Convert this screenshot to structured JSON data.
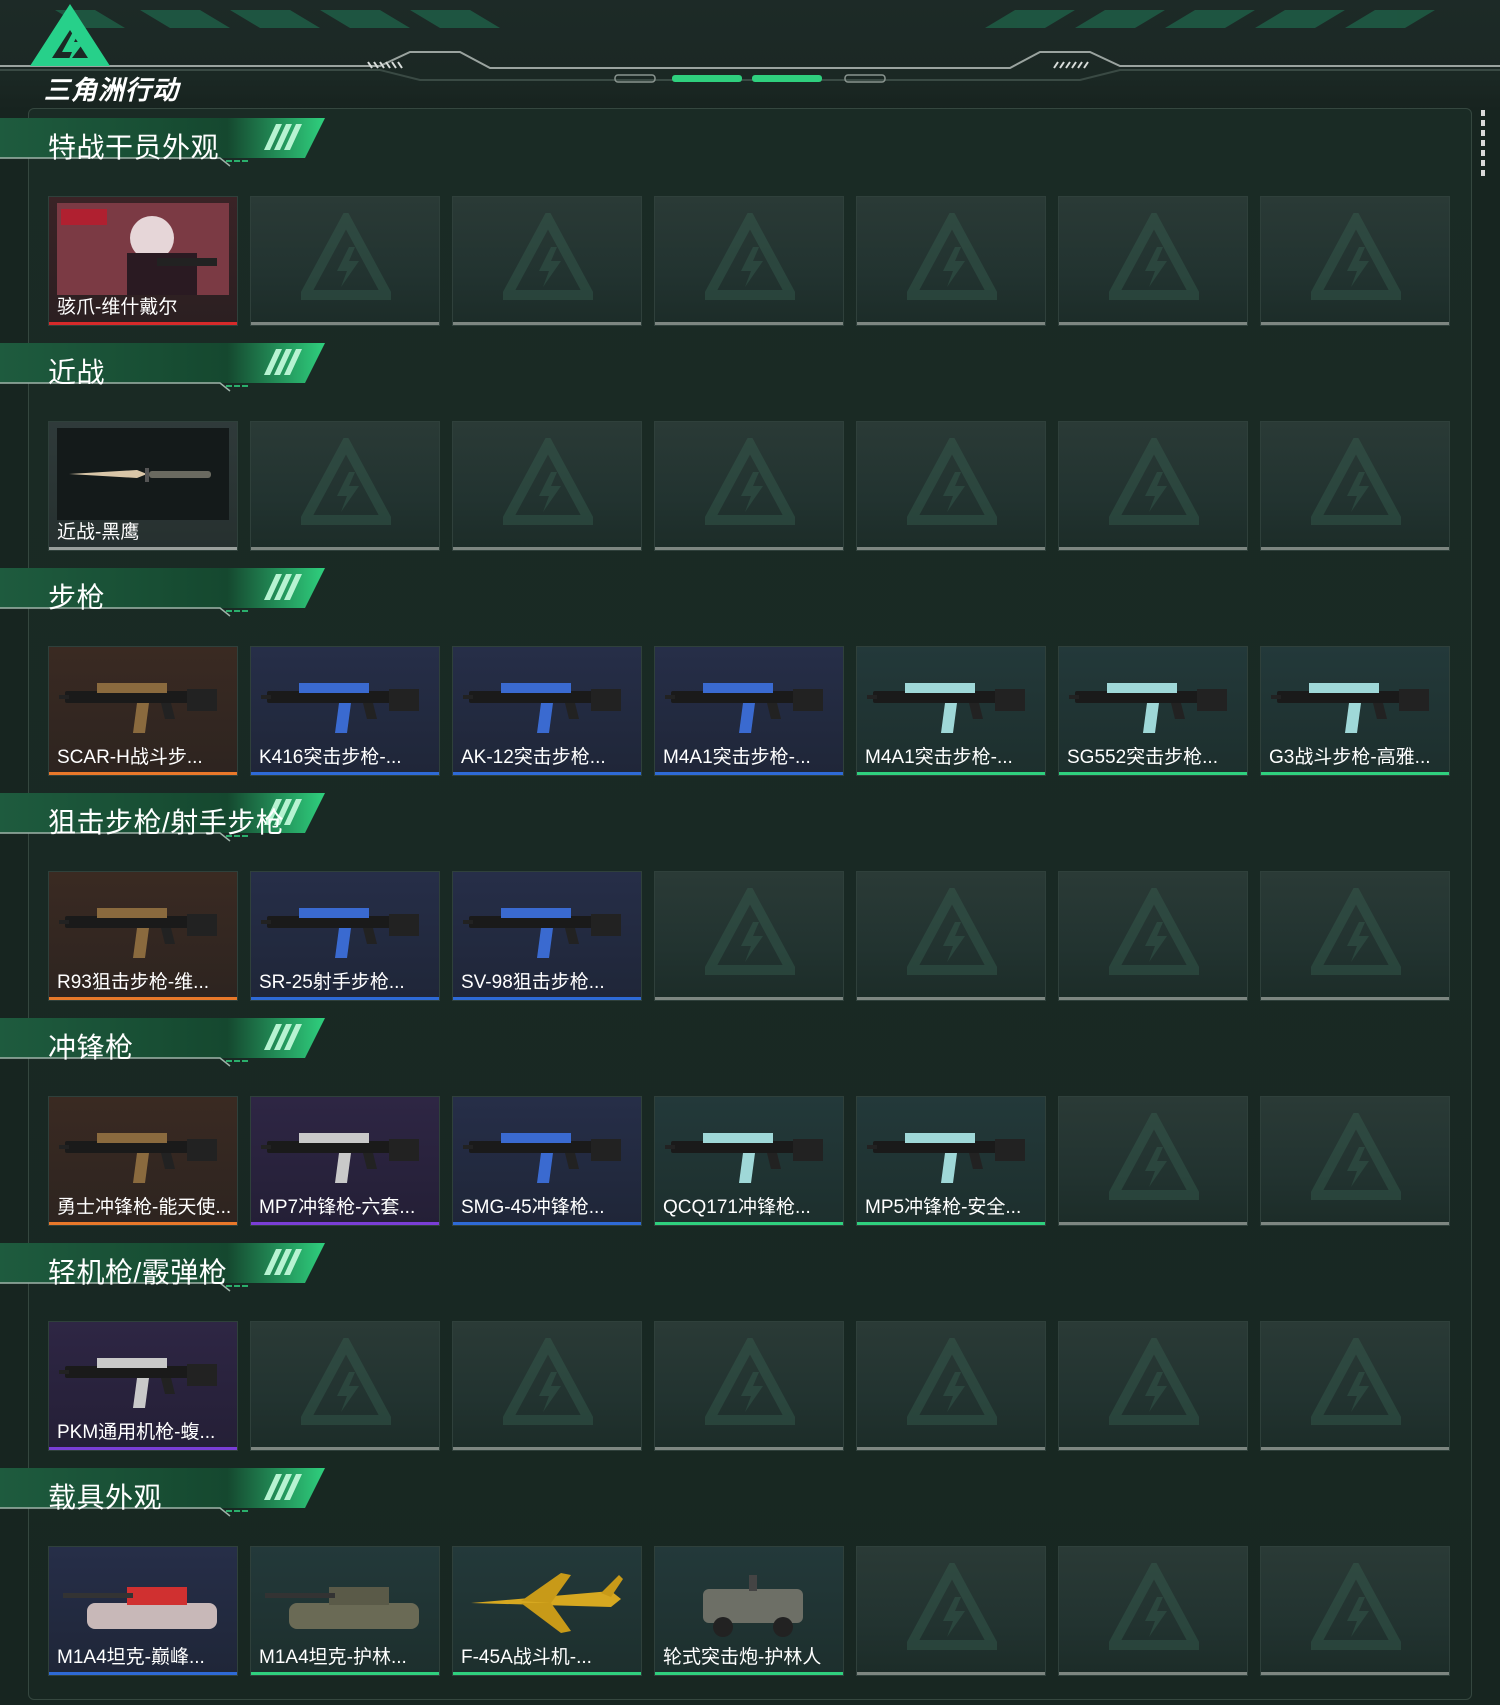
{
  "app": {
    "logo_text": "三角洲行动"
  },
  "colors": {
    "accent": "#2fd07e",
    "background": "#172520",
    "quality_orange": "#e8782a",
    "quality_blue": "#2e6ad6",
    "quality_green": "#2fd07e",
    "quality_purple": "#7a3ed6",
    "quality_red": "#d62a2a"
  },
  "sections": [
    {
      "title": "特战干员外观",
      "items": [
        {
          "label": "骇爪-维什戴尔",
          "quality": "red",
          "icon": "operator-portrait"
        }
      ]
    },
    {
      "title": "近战",
      "items": [
        {
          "label": "近战-黑鹰",
          "quality": "gray",
          "icon": "knife"
        }
      ]
    },
    {
      "title": "步枪",
      "items": [
        {
          "label": "SCAR-H战斗步...",
          "quality": "orange",
          "icon": "rifle"
        },
        {
          "label": "K416突击步枪-...",
          "quality": "blue",
          "icon": "rifle"
        },
        {
          "label": "AK-12突击步枪...",
          "quality": "blue",
          "icon": "rifle"
        },
        {
          "label": "M4A1突击步枪-...",
          "quality": "blue",
          "icon": "rifle"
        },
        {
          "label": "M4A1突击步枪-...",
          "quality": "green",
          "icon": "rifle"
        },
        {
          "label": "SG552突击步枪...",
          "quality": "green",
          "icon": "rifle"
        },
        {
          "label": "G3战斗步枪-高雅...",
          "quality": "green",
          "icon": "rifle"
        }
      ]
    },
    {
      "title": "狙击步枪/射手步枪",
      "items": [
        {
          "label": "R93狙击步枪-维...",
          "quality": "orange",
          "icon": "sniper-rifle"
        },
        {
          "label": "SR-25射手步枪...",
          "quality": "blue",
          "icon": "sniper-rifle"
        },
        {
          "label": "SV-98狙击步枪...",
          "quality": "blue",
          "icon": "sniper-rifle"
        }
      ]
    },
    {
      "title": "冲锋枪",
      "items": [
        {
          "label": "勇士冲锋枪-能天使...",
          "quality": "orange",
          "icon": "smg"
        },
        {
          "label": "MP7冲锋枪-六套...",
          "quality": "purple",
          "icon": "smg"
        },
        {
          "label": "SMG-45冲锋枪...",
          "quality": "blue",
          "icon": "smg"
        },
        {
          "label": "QCQ171冲锋枪...",
          "quality": "green",
          "icon": "smg"
        },
        {
          "label": "MP5冲锋枪-安全...",
          "quality": "green",
          "icon": "smg"
        }
      ]
    },
    {
      "title": "轻机枪/霰弹枪",
      "items": [
        {
          "label": "PKM通用机枪-蝮...",
          "quality": "purple",
          "icon": "machine-gun"
        }
      ]
    },
    {
      "title": "载具外观",
      "items": [
        {
          "label": "M1A4坦克-巅峰...",
          "quality": "blue",
          "icon": "tank"
        },
        {
          "label": "M1A4坦克-护林...",
          "quality": "green",
          "icon": "tank"
        },
        {
          "label": "F-45A战斗机-...",
          "quality": "green",
          "icon": "fighter-jet"
        },
        {
          "label": "轮式突击炮-护林人",
          "quality": "green",
          "icon": "armored-vehicle"
        }
      ]
    }
  ]
}
